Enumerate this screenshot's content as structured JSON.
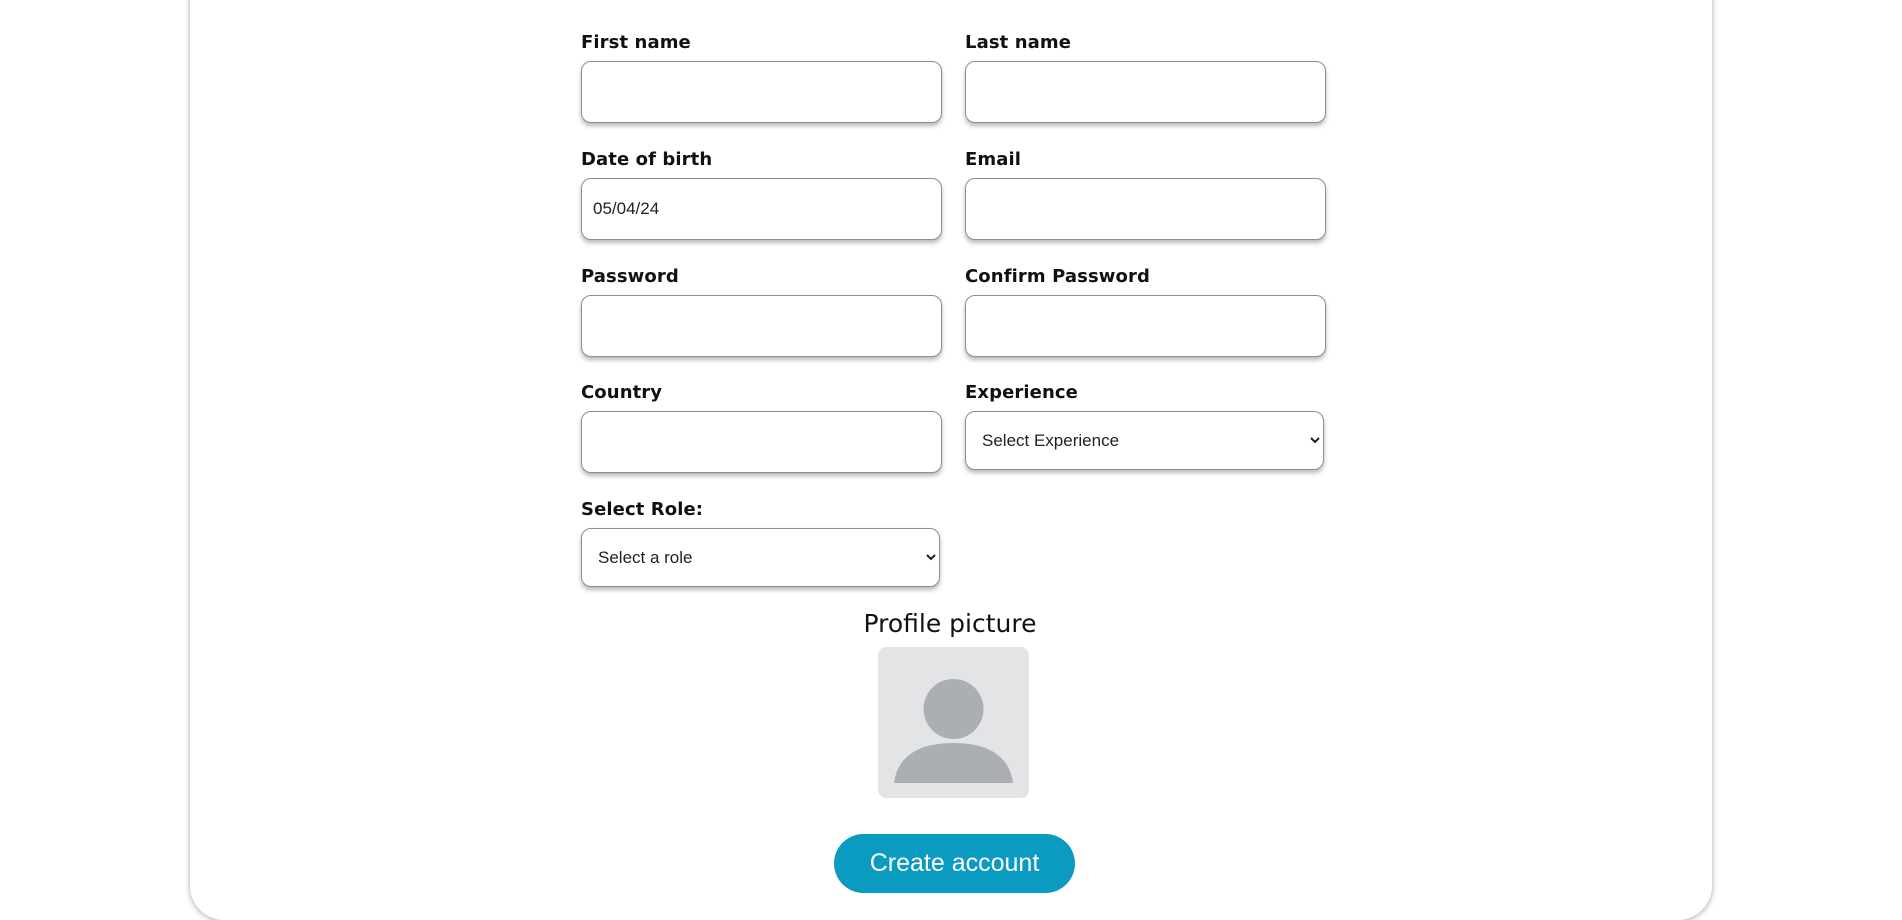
{
  "form": {
    "first_name": {
      "label": "First name",
      "value": "",
      "placeholder": ""
    },
    "last_name": {
      "label": "Last name",
      "value": "",
      "placeholder": ""
    },
    "date_of_birth": {
      "label": "Date of birth",
      "value": "05/04/24"
    },
    "email": {
      "label": "Email",
      "value": ""
    },
    "password": {
      "label": "Password",
      "value": ""
    },
    "confirm_password": {
      "label": "Confirm Password",
      "value": ""
    },
    "country": {
      "label": "Country",
      "value": ""
    },
    "experience": {
      "label": "Experience",
      "selected": "Select Experience"
    },
    "role": {
      "label": "Select Role:",
      "selected": "Select a role"
    }
  },
  "profile": {
    "title": "Profile picture",
    "icon": "user-silhouette-icon",
    "background_color": "#e3e4e5",
    "icon_color": "#abafb3"
  },
  "actions": {
    "create_label": "Create account",
    "button_color": "#0b9bc0"
  }
}
